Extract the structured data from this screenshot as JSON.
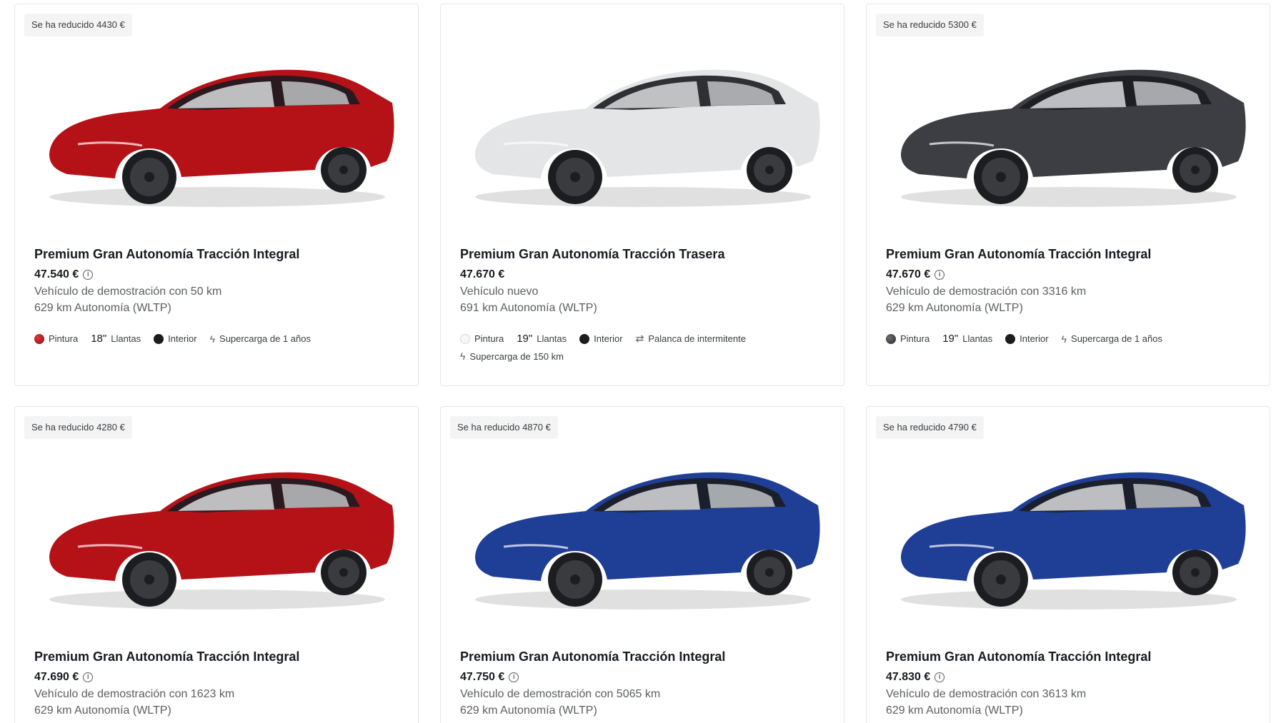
{
  "cards": [
    {
      "badge": "Se ha reducido 4430 €",
      "title": "Premium Gran Autonomía Tracción Integral",
      "price": "47.540 €",
      "condition": "Vehículo de demostración con 50 km",
      "range": "629 km Autonomía (WLTP)",
      "car_color": "#b51218",
      "paint_label": "Pintura",
      "wheel_size": "18\"",
      "wheel_label": "Llantas",
      "interior_label": "Interior",
      "charging": "Supercarga de 1 años"
    },
    {
      "badge": "",
      "title": "Premium Gran Autonomía Tracción Trasera",
      "price": "47.670 €",
      "condition": "Vehículo nuevo",
      "range": "691 km Autonomía (WLTP)",
      "car_color": "#e4e5e7",
      "paint_label": "Pintura",
      "wheel_size": "19\"",
      "wheel_label": "Llantas",
      "interior_label": "Interior",
      "turn_signal": "Palanca de intermitente",
      "charging": "Supercarga de 150 km"
    },
    {
      "badge": "Se ha reducido 5300 €",
      "title": "Premium Gran Autonomía Tracción Integral",
      "price": "47.670 €",
      "condition": "Vehículo de demostración con 3316 km",
      "range": "629 km Autonomía (WLTP)",
      "car_color": "#3c3e43",
      "paint_label": "Pintura",
      "wheel_size": "19\"",
      "wheel_label": "Llantas",
      "interior_label": "Interior",
      "charging": "Supercarga de 1 años"
    },
    {
      "badge": "Se ha reducido 4280 €",
      "title": "Premium Gran Autonomía Tracción Integral",
      "price": "47.690 €",
      "condition": "Vehículo de demostración con 1623 km",
      "range": "629 km Autonomía (WLTP)",
      "car_color": "#b51218"
    },
    {
      "badge": "Se ha reducido 4870 €",
      "title": "Premium Gran Autonomía Tracción Integral",
      "price": "47.750 €",
      "condition": "Vehículo de demostración con 5065 km",
      "range": "629 km Autonomía (WLTP)",
      "car_color": "#1f3e95"
    },
    {
      "badge": "Se ha reducido 4790 €",
      "title": "Premium Gran Autonomía Tracción Integral",
      "price": "47.830 €",
      "condition": "Vehículo de demostración con 3613 km",
      "range": "629 km Autonomía (WLTP)",
      "car_color": "#1f3e95"
    }
  ]
}
